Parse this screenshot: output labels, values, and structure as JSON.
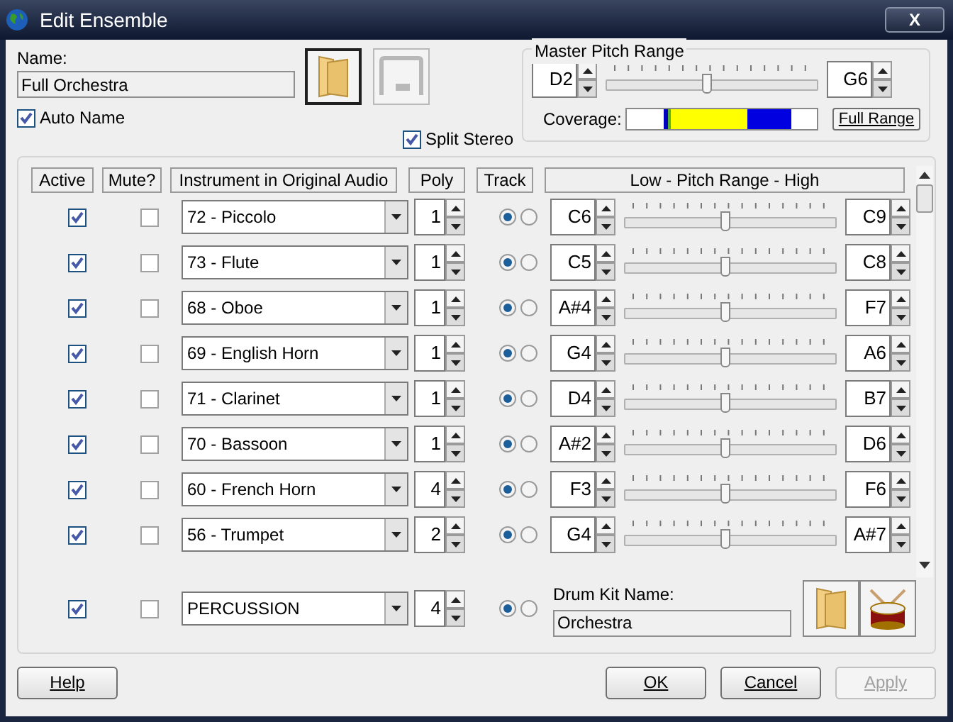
{
  "window": {
    "title": "Edit Ensemble",
    "close_label": "X"
  },
  "name_label": "Name:",
  "name_value": "Full Orchestra",
  "auto_name": {
    "label": "Auto Name",
    "checked": true
  },
  "split_stereo": {
    "label": "Split Stereo",
    "checked": true
  },
  "master": {
    "title": "Master Pitch Range",
    "low": "D2",
    "high": "G6",
    "level": 0.47,
    "coverage_label": "Coverage:",
    "full_range": "Full Range"
  },
  "columns": [
    "Active",
    "Mute?",
    "Instrument in Original Audio",
    "Poly",
    "Track",
    "Low - Pitch Range - High"
  ],
  "rows": [
    {
      "active": true,
      "muted": false,
      "instrument": "72 - Piccolo",
      "poly": "1",
      "track_selected": [
        true,
        false
      ],
      "low": "C6",
      "high": "C9",
      "level": 0.47
    },
    {
      "active": true,
      "muted": false,
      "instrument": "73 - Flute",
      "poly": "1",
      "track_selected": [
        true,
        false
      ],
      "low": "C5",
      "high": "C8",
      "level": 0.47
    },
    {
      "active": true,
      "muted": false,
      "instrument": "68 - Oboe",
      "poly": "1",
      "track_selected": [
        true,
        false
      ],
      "low": "A#4",
      "high": "F7",
      "level": 0.47
    },
    {
      "active": true,
      "muted": false,
      "instrument": "69 - English Horn",
      "poly": "1",
      "track_selected": [
        true,
        false
      ],
      "low": "G4",
      "high": "A6",
      "level": 0.47
    },
    {
      "active": true,
      "muted": false,
      "instrument": "71 - Clarinet",
      "poly": "1",
      "track_selected": [
        true,
        false
      ],
      "low": "D4",
      "high": "B7",
      "level": 0.47
    },
    {
      "active": true,
      "muted": false,
      "instrument": "70 - Bassoon",
      "poly": "1",
      "track_selected": [
        true,
        false
      ],
      "low": "A#2",
      "high": "D6",
      "level": 0.47
    },
    {
      "active": true,
      "muted": false,
      "instrument": "60 - French Horn",
      "poly": "4",
      "track_selected": [
        true,
        false
      ],
      "low": "F3",
      "high": "F6",
      "level": 0.47
    },
    {
      "active": true,
      "muted": false,
      "instrument": "56 - Trumpet",
      "poly": "2",
      "track_selected": [
        true,
        false
      ],
      "low": "G4",
      "high": "A#7",
      "level": 0.47
    }
  ],
  "percussion": {
    "active": true,
    "muted": false,
    "instrument": "PERCUSSION",
    "poly": "4",
    "track_selected": [
      true,
      false
    ],
    "drum_kit_label": "Drum Kit Name:",
    "drum_kit": "Orchestra"
  },
  "buttons": [
    {
      "label": "Help",
      "disabled": false
    },
    {
      "label": "OK",
      "disabled": false
    },
    {
      "label": "Cancel",
      "disabled": false
    },
    {
      "label": "Apply",
      "disabled": true
    }
  ]
}
